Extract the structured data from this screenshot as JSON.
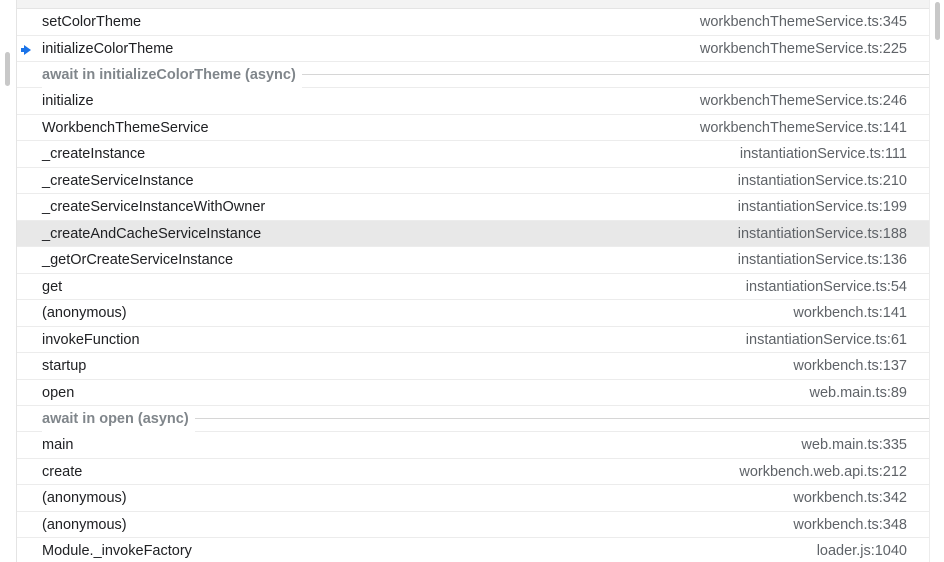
{
  "call_stack": {
    "entries": [
      {
        "kind": "frame",
        "name": "setColorTheme",
        "location": "workbenchThemeService.ts:345",
        "current": false,
        "selected": false
      },
      {
        "kind": "frame",
        "name": "initializeColorTheme",
        "location": "workbenchThemeService.ts:225",
        "current": true,
        "selected": false
      },
      {
        "kind": "async",
        "label": "await in initializeColorTheme (async)"
      },
      {
        "kind": "frame",
        "name": "initialize",
        "location": "workbenchThemeService.ts:246",
        "current": false,
        "selected": false
      },
      {
        "kind": "frame",
        "name": "WorkbenchThemeService",
        "location": "workbenchThemeService.ts:141",
        "current": false,
        "selected": false
      },
      {
        "kind": "frame",
        "name": "_createInstance",
        "location": "instantiationService.ts:111",
        "current": false,
        "selected": false
      },
      {
        "kind": "frame",
        "name": "_createServiceInstance",
        "location": "instantiationService.ts:210",
        "current": false,
        "selected": false
      },
      {
        "kind": "frame",
        "name": "_createServiceInstanceWithOwner",
        "location": "instantiationService.ts:199",
        "current": false,
        "selected": false
      },
      {
        "kind": "frame",
        "name": "_createAndCacheServiceInstance",
        "location": "instantiationService.ts:188",
        "current": false,
        "selected": true
      },
      {
        "kind": "frame",
        "name": "_getOrCreateServiceInstance",
        "location": "instantiationService.ts:136",
        "current": false,
        "selected": false
      },
      {
        "kind": "frame",
        "name": "get",
        "location": "instantiationService.ts:54",
        "current": false,
        "selected": false
      },
      {
        "kind": "frame",
        "name": "(anonymous)",
        "location": "workbench.ts:141",
        "current": false,
        "selected": false
      },
      {
        "kind": "frame",
        "name": "invokeFunction",
        "location": "instantiationService.ts:61",
        "current": false,
        "selected": false
      },
      {
        "kind": "frame",
        "name": "startup",
        "location": "workbench.ts:137",
        "current": false,
        "selected": false
      },
      {
        "kind": "frame",
        "name": "open",
        "location": "web.main.ts:89",
        "current": false,
        "selected": false
      },
      {
        "kind": "async",
        "label": "await in open (async)"
      },
      {
        "kind": "frame",
        "name": "main",
        "location": "web.main.ts:335",
        "current": false,
        "selected": false
      },
      {
        "kind": "frame",
        "name": "create",
        "location": "workbench.web.api.ts:212",
        "current": false,
        "selected": false
      },
      {
        "kind": "frame",
        "name": "(anonymous)",
        "location": "workbench.ts:342",
        "current": false,
        "selected": false
      },
      {
        "kind": "frame",
        "name": "(anonymous)",
        "location": "workbench.ts:348",
        "current": false,
        "selected": false
      },
      {
        "kind": "frame",
        "name": "Module._invokeFactory",
        "location": "loader.js:1040",
        "current": false,
        "selected": false
      }
    ]
  },
  "colors": {
    "current_frame_arrow": "#1a73e8",
    "selected_row_bg": "#e8e8e8",
    "async_label": "#80868b"
  },
  "icons": {
    "current_frame": "arrow-right-icon"
  }
}
